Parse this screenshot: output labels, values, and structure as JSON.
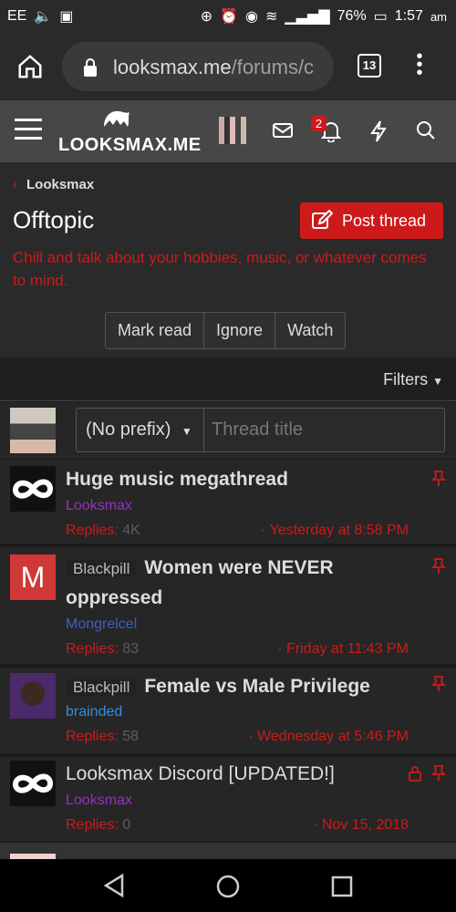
{
  "status_bar": {
    "carrier": "EE",
    "battery": "76%",
    "time": "1:57",
    "ampm": "am"
  },
  "browser": {
    "url_host": "looksmax.me",
    "url_path": "/forums/c",
    "tab_count": "13"
  },
  "site": {
    "logo": "LOOKSMAX.ME",
    "notification_count": "2"
  },
  "breadcrumb": {
    "label": "Looksmax"
  },
  "forum": {
    "title": "Offtopic",
    "post_thread_label": "Post thread",
    "description": "Chill and talk about your hobbies, music, or whatever comes to mind.",
    "actions": [
      "Mark read",
      "Ignore",
      "Watch"
    ]
  },
  "filters_label": "Filters",
  "new_thread": {
    "prefix": "(No prefix)",
    "title_placeholder": "Thread title"
  },
  "threads": [
    {
      "prefix": "",
      "title": "Huge music megathread",
      "author": "Looksmax",
      "replies_label": "Replies:",
      "replies": "4K",
      "date": "Yesterday at 8:58 PM",
      "title_bold": true
    },
    {
      "prefix": "Blackpill",
      "title": "Women were NEVER oppressed",
      "author": "Mongrelcel",
      "replies_label": "Replies:",
      "replies": "83",
      "date": "Friday at 11:43 PM",
      "title_bold": true,
      "avatar_letter": "M"
    },
    {
      "prefix": "Blackpill",
      "title": "Female vs Male Privilege",
      "author": "brainded",
      "replies_label": "Replies:",
      "replies": "58",
      "date": "Wednesday at 5:46 PM",
      "title_bold": true
    },
    {
      "prefix": "",
      "title": "Looksmax Discord [UPDATED!]",
      "author": "Looksmax",
      "replies_label": "Replies:",
      "replies": "0",
      "date": "Nov 15, 2018",
      "title_bold": false
    }
  ],
  "colors": {
    "accent": "#cc1a1a",
    "author_looksmax": "#9b2cc7",
    "author_mongrelcel": "#3f5fbf",
    "author_brainded": "#2f8fe8"
  }
}
